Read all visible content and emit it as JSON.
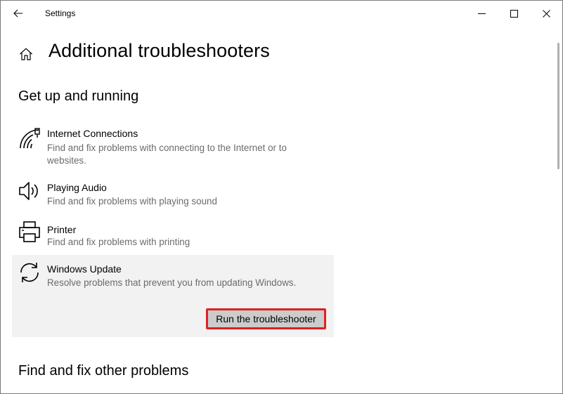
{
  "window": {
    "title": "Settings"
  },
  "page": {
    "title": "Additional troubleshooters"
  },
  "sections": {
    "get_up": "Get up and running",
    "other": "Find and fix other problems"
  },
  "troubleshooters": [
    {
      "name": "Internet Connections",
      "description": "Find and fix problems with connecting to the Internet or to websites.",
      "icon": "network-icon"
    },
    {
      "name": "Playing Audio",
      "description": "Find and fix problems with playing sound",
      "icon": "speaker-icon"
    },
    {
      "name": "Printer",
      "description": "Find and fix problems with printing",
      "icon": "printer-icon"
    },
    {
      "name": "Windows Update",
      "description": "Resolve problems that prevent you from updating Windows.",
      "icon": "sync-icon",
      "selected": true,
      "button_label": "Run the troubleshooter"
    }
  ],
  "colors": {
    "selected_bg": "#f2f2f2",
    "button_bg": "#cccccc",
    "highlight_border": "#e02020",
    "description_text": "#6b6b6b"
  }
}
